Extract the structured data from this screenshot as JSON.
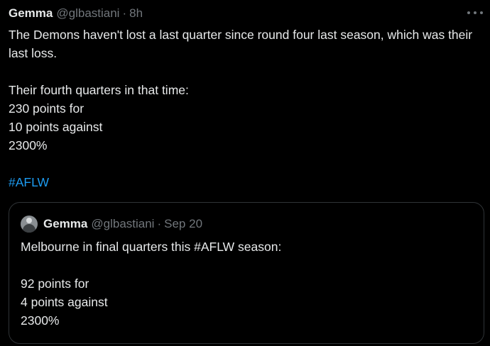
{
  "tweet": {
    "author_name": "Gemma",
    "author_handle": "@glbastiani",
    "separator": "·",
    "time": "8h",
    "lines": {
      "line1": "The Demons haven't lost a last quarter since round four last season, which was their last loss.",
      "line2": "Their fourth quarters in that time:",
      "line3": "230 points for",
      "line4": "10 points against",
      "line5": "2300%"
    },
    "hashtag": "#AFLW"
  },
  "quoted_tweet": {
    "author_name": "Gemma",
    "author_handle": "@glbastiani",
    "separator": "·",
    "date": "Sep 20",
    "lines": {
      "line1": "Melbourne in final quarters this #AFLW season:",
      "line2": "92 points for",
      "line3": "4 points against",
      "line4": "2300%"
    }
  },
  "icons": {
    "more": "more-options-icon",
    "avatar": "avatar-icon"
  },
  "colors": {
    "background": "#000000",
    "text": "#e7e9ea",
    "muted": "#71767b",
    "link": "#1d9bf0",
    "border": "#2f3336"
  }
}
